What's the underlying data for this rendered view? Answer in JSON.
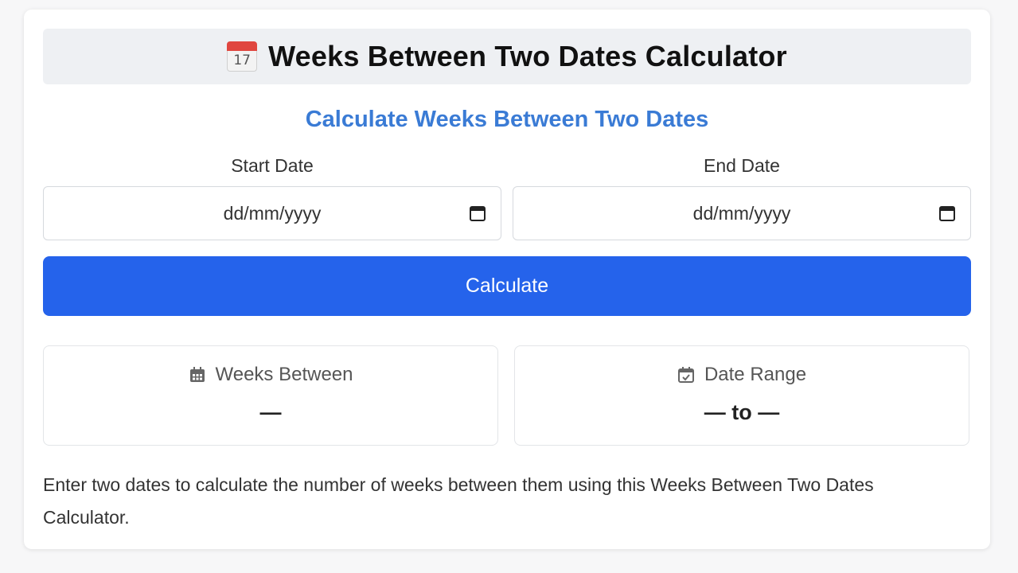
{
  "header": {
    "icon": "calendar-emoji",
    "calendar_day": "17",
    "title": "Weeks Between Two Dates Calculator"
  },
  "subtitle": "Calculate Weeks Between Two Dates",
  "start_date": {
    "label": "Start Date",
    "placeholder": "dd/mm/yyyy",
    "icon": "calendar-picker-icon"
  },
  "end_date": {
    "label": "End Date",
    "placeholder": "dd/mm/yyyy",
    "icon": "calendar-picker-icon"
  },
  "calculate_button": {
    "label": "Calculate"
  },
  "results": {
    "weeks_between": {
      "label": "Weeks Between",
      "icon": "calendar-grid-icon",
      "value": "—"
    },
    "date_range": {
      "label": "Date Range",
      "icon": "calendar-check-icon",
      "value": "— to —"
    }
  },
  "description": "Enter two dates to calculate the number of weeks between them using this Weeks Between Two Dates Calculator.",
  "colors": {
    "accent_blue": "#2563eb",
    "subtitle_blue": "#3a7bd5",
    "header_bg": "#eef0f3"
  }
}
